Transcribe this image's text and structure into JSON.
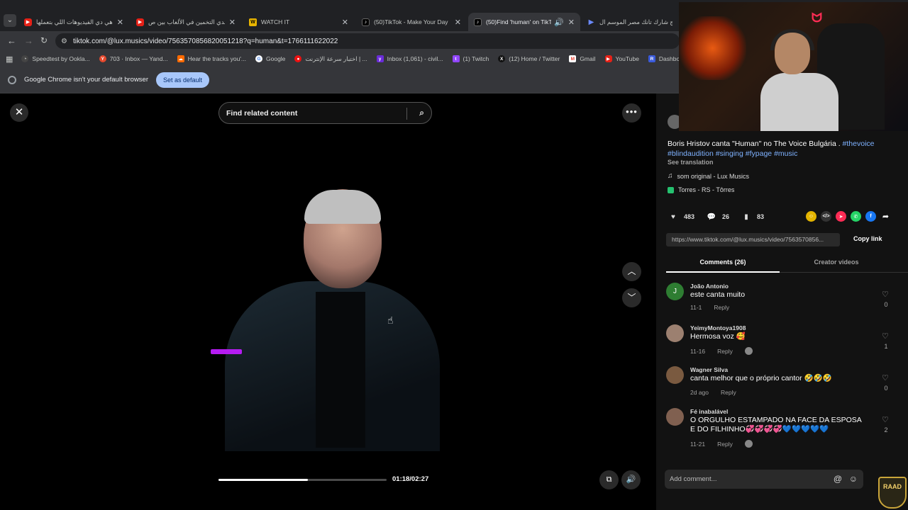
{
  "tabs": [
    {
      "title": "هي دي الفيديوهات اللي بتعملها...",
      "icon": "youtube-icon",
      "active": false
    },
    {
      "title": "تحدي التخمين في الألعاب بين ص...",
      "icon": "youtube-icon",
      "active": false
    },
    {
      "title": "WATCH IT",
      "icon": "watchit-icon",
      "active": false
    },
    {
      "title": "(50)TikTok - Make Your Day",
      "icon": "tiktok-icon",
      "active": false
    },
    {
      "title": "(50)Find 'human' on TikTok",
      "icon": "tiktok-icon",
      "active": true
    },
    {
      "title": "برنامج شارك تانك مصر الموسم ال...",
      "icon": "play-icon",
      "active": false
    }
  ],
  "address": {
    "url": "tiktok.com/@lux.musics/video/7563570856820051218?q=human&t=1766111622022"
  },
  "bookmarks": [
    {
      "label": "Speedtest by Ookla...",
      "color": "#444"
    },
    {
      "label": "703 · Inbox — Yand...",
      "color": "#e6492d"
    },
    {
      "label": "Hear the tracks you'...",
      "color": "#ff6a00"
    },
    {
      "label": "Google",
      "color": "#4285f4"
    },
    {
      "label": "اختبار سرعة الإنترنت | ...",
      "color": "#e11"
    },
    {
      "label": "Inbox (1,061) - civil...",
      "color": "#6a2bd9"
    },
    {
      "label": "(1) Twitch",
      "color": "#9146ff"
    },
    {
      "label": "(12) Home / Twitter",
      "color": "#111"
    },
    {
      "label": "Gmail",
      "color": "#ea4335"
    },
    {
      "label": "YouTube",
      "color": "#e62117"
    },
    {
      "label": "Dashboard - Restre...",
      "color": "#3b5bdb"
    }
  ],
  "infobar": {
    "message": "Google Chrome isn't your default browser",
    "button": "Set as default"
  },
  "player": {
    "search_placeholder": "Find related content",
    "time": "01:18/02:27",
    "progress": 0.53
  },
  "panel": {
    "description_main": "Boris Hristov canta \"Human\" no The Voice Bulgária . ",
    "description_tags": [
      "#thevoice",
      "#blindaudition",
      "#singing",
      "#fypage",
      "#music"
    ],
    "see_translation": "See translation",
    "sound": "som original - Lux Musics",
    "location": "Torres - RS - Tôrres",
    "likes": "483",
    "comments_count": "26",
    "saves": "83",
    "link": "https://www.tiktok.com/@lux.musics/video/7563570856...",
    "copy_link": "Copy link",
    "tab_comments": "Comments (26)",
    "tab_creator": "Creator videos",
    "add_comment": "Add comment..."
  },
  "comments": [
    {
      "user": "João Antonio",
      "text": "este canta muito",
      "date": "11-1",
      "reply": "Reply",
      "likes": "0",
      "avatar_letter": "J",
      "avatar_color": "#2e7d32"
    },
    {
      "user": "YeimyMontoya1908",
      "text": "Hermosa voz 🥰",
      "date": "11-16",
      "reply": "Reply",
      "likes": "1",
      "avatar_letter": "",
      "avatar_color": "#9c8070"
    },
    {
      "user": "Wagner Silva",
      "text": "canta melhor que o próprio cantor 🤣🤣🤣",
      "date": "2d ago",
      "reply": "Reply",
      "likes": "0",
      "avatar_letter": "",
      "avatar_color": "#7a5a40"
    },
    {
      "user": "Fé inabalável",
      "text": "O ORGULHO ESTAMPADO NA FACE DA ESPOSA E DO FILHINHO💞💞💞💞💙💙💙💙💙",
      "date": "11-21",
      "reply": "Reply",
      "likes": "2",
      "avatar_letter": "",
      "avatar_color": "#806050"
    }
  ],
  "overlay": {
    "badge": "RAAD"
  }
}
